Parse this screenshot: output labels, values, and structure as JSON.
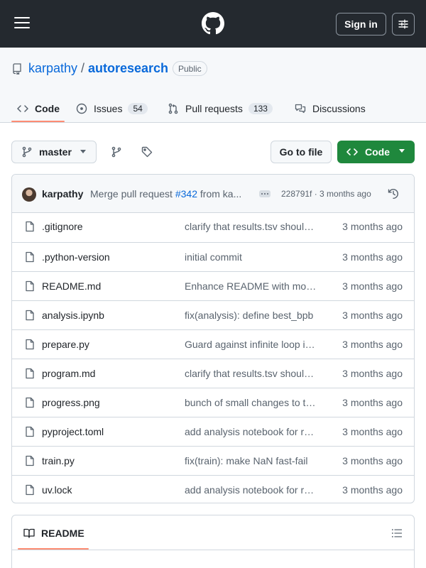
{
  "header": {
    "sign_in_label": "Sign in",
    "menu_icon": "hamburger-icon",
    "logo_icon": "github-mark-icon",
    "settings_icon": "sliders-icon"
  },
  "repo": {
    "owner": "karpathy",
    "separator": "/",
    "name": "autoresearch",
    "visibility": "Public"
  },
  "tabs": [
    {
      "label": "Code",
      "icon": "code-icon",
      "active": true
    },
    {
      "label": "Issues",
      "count": "54",
      "icon": "issue-opened-icon"
    },
    {
      "label": "Pull requests",
      "count": "133",
      "icon": "git-pull-request-icon"
    },
    {
      "label": "Discussions",
      "icon": "comment-discussion-icon"
    }
  ],
  "toolbar": {
    "branch": "master",
    "go_to_file": "Go to file",
    "code_label": "Code"
  },
  "commit": {
    "author": "karpathy",
    "message_prefix": "Merge pull request ",
    "pr_ref": "#342",
    "message_suffix": " from ka...",
    "meta": "228791f · 3 months ago"
  },
  "files": [
    {
      "name": ".gitignore",
      "message": "clarify that results.tsv should not be committed",
      "age": "3 months ago"
    },
    {
      "name": ".python-version",
      "message": "initial commit",
      "age": "3 months ago"
    },
    {
      "name": "README.md",
      "message": "Enhance README with more details",
      "age": "3 months ago"
    },
    {
      "name": "analysis.ipynb",
      "message": "fix(analysis): define best_bpb",
      "age": "3 months ago"
    },
    {
      "name": "prepare.py",
      "message": "Guard against infinite loop in prepare",
      "age": "3 months ago"
    },
    {
      "name": "program.md",
      "message": "clarify that results.tsv should not be committed",
      "age": "3 months ago"
    },
    {
      "name": "progress.png",
      "message": "bunch of small changes to the program",
      "age": "3 months ago"
    },
    {
      "name": "pyproject.toml",
      "message": "add analysis notebook for results",
      "age": "3 months ago"
    },
    {
      "name": "train.py",
      "message": "fix(train): make NaN fast-fail",
      "age": "3 months ago"
    },
    {
      "name": "uv.lock",
      "message": "add analysis notebook for results",
      "age": "3 months ago"
    }
  ],
  "readme": {
    "title": "README"
  },
  "colors": {
    "header_bg": "#24292f",
    "link": "#0969da",
    "primary_green": "#1f883d",
    "active_tab_underline": "#fd8c73"
  }
}
